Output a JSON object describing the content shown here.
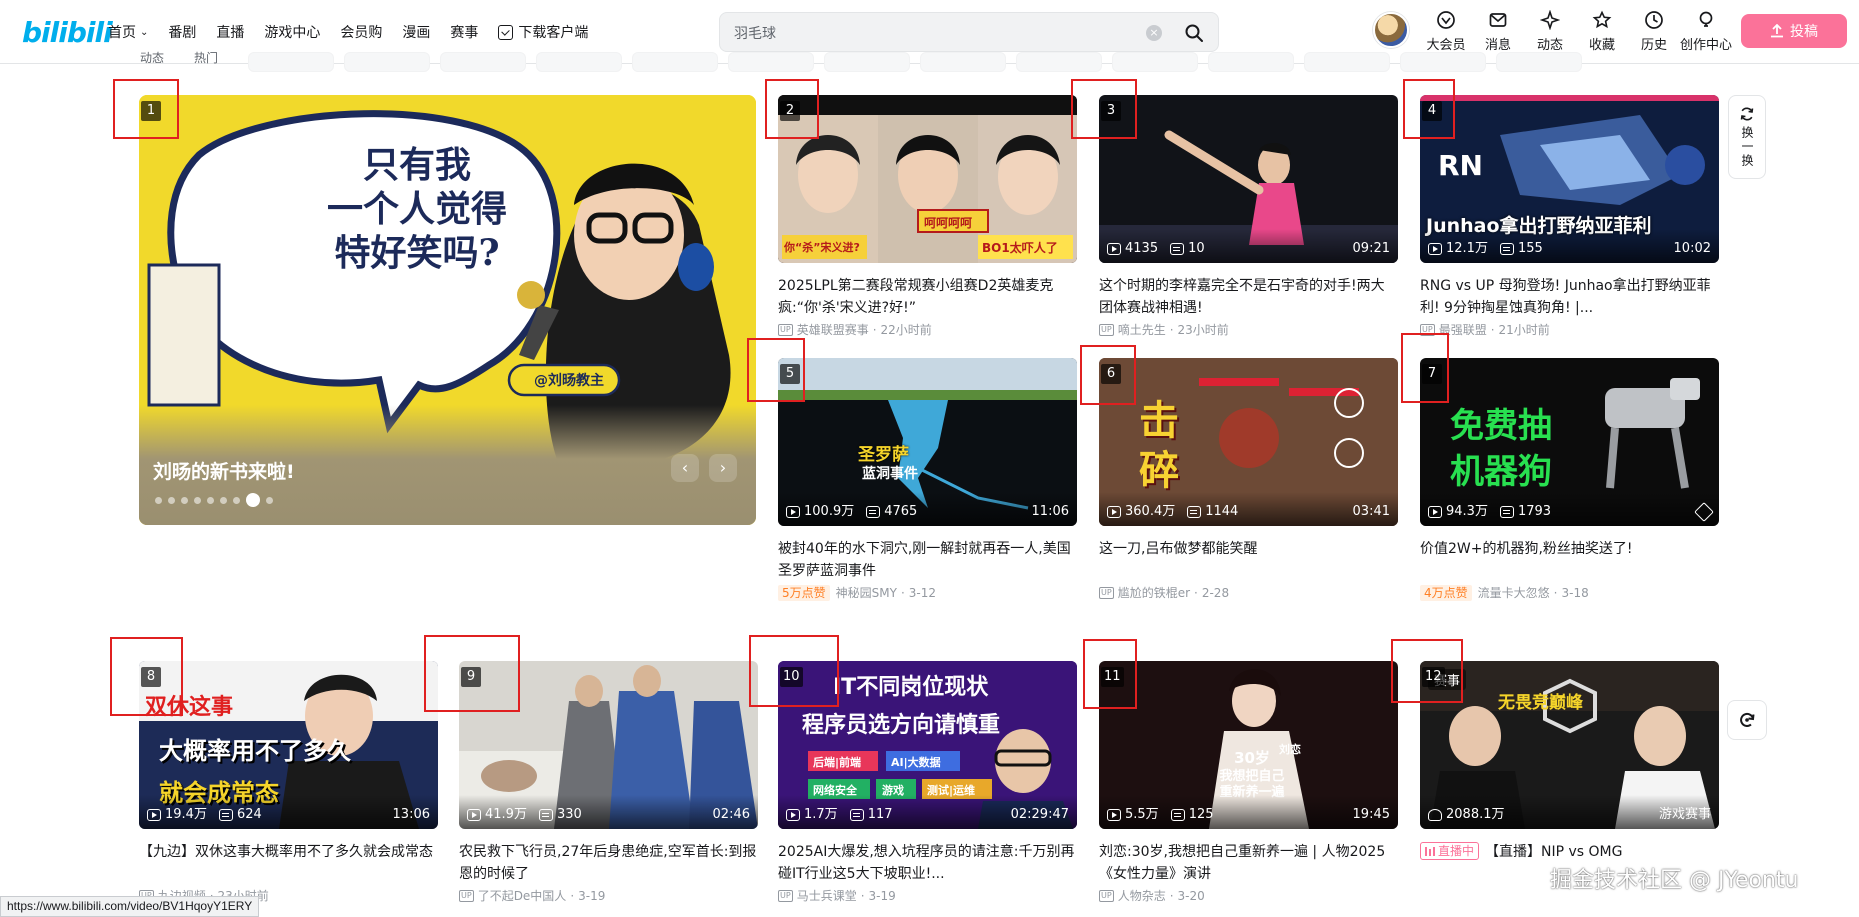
{
  "header": {
    "logo": "bilibili",
    "nav": [
      {
        "label": "首页",
        "has_dropdown": true
      },
      {
        "label": "番剧"
      },
      {
        "label": "直播"
      },
      {
        "label": "游戏中心"
      },
      {
        "label": "会员购"
      },
      {
        "label": "漫画"
      },
      {
        "label": "赛事"
      },
      {
        "label": "下载客户端",
        "icon": "download-icon"
      }
    ],
    "search": {
      "value": "羽毛球"
    },
    "right_icons": [
      {
        "label": "大会员",
        "icon": "vip-icon"
      },
      {
        "label": "消息",
        "icon": "message-icon"
      },
      {
        "label": "动态",
        "icon": "dynamic-icon"
      },
      {
        "label": "收藏",
        "icon": "favorite-icon"
      },
      {
        "label": "历史",
        "icon": "history-icon"
      },
      {
        "label": "创作中心",
        "icon": "creator-icon"
      }
    ],
    "upload_label": "投稿",
    "channel_labels": [
      "动态",
      "热门"
    ]
  },
  "carousel": {
    "title": "刘旸的新书来啦!",
    "dot_count": 10,
    "active_dot": 8,
    "overlay_lines": [
      "只有我",
      "一个人觉得",
      "特好笑吗?"
    ],
    "author_tag": "@刘旸教主"
  },
  "cards": [
    {
      "num": "2",
      "plays": "",
      "danmaku": "",
      "duration": "",
      "title": "2025LPL第二赛段常规赛小组赛D2英雄麦克疯:“你'杀'宋义进?好!”",
      "author": "英雄联盟赛事",
      "date": "22小时前",
      "overlay": [
        "你“杀”宋义进?",
        "呵呵呵呵",
        "BO1太吓人了"
      ]
    },
    {
      "num": "3",
      "plays": "4135",
      "danmaku": "10",
      "duration": "09:21",
      "title": "这个时期的李梓嘉完全不是石宇奇的对手!两大团体赛战神相遇!",
      "author": "嘀土先生",
      "date": "23小时前",
      "overlay": []
    },
    {
      "num": "4",
      "plays": "12.1万",
      "danmaku": "155",
      "duration": "10:02",
      "title": "RNG vs UP 母狗登场! Junhao拿出打野纳亚菲利! 9分钟掏星蚀真狗角! |...",
      "author": "最强联盟",
      "date": "21小时前",
      "overlay": [
        "Junhao拿出打野纳亚菲利"
      ]
    },
    {
      "num": "5",
      "plays": "100.9万",
      "danmaku": "4765",
      "duration": "11:06",
      "title": "被封40年的水下洞穴,刚一解封就再吞一人,美国圣罗萨蓝洞事件",
      "likes": "5万点赞",
      "author": "神秘园SMY",
      "date": "3-12",
      "overlay": [
        "圣罗萨",
        "蓝洞事件"
      ]
    },
    {
      "num": "6",
      "plays": "360.4万",
      "danmaku": "1144",
      "duration": "03:41",
      "title": "这一刀,吕布做梦都能笑醒",
      "author": "尴尬的铁棍er",
      "date": "2-28",
      "overlay": [
        "击",
        "碎"
      ]
    },
    {
      "num": "7",
      "plays": "94.3万",
      "danmaku": "1793",
      "duration": "",
      "title": "价值2W+的机器狗,粉丝抽奖送了!",
      "likes": "4万点赞",
      "author": "流量卡大忽悠",
      "date": "3-18",
      "overlay": [
        "免费抽",
        "机器狗"
      ]
    },
    {
      "num": "8",
      "plays": "19.4万",
      "danmaku": "624",
      "duration": "13:06",
      "title": "【九边】双休这事大概率用不了多久就会成常态",
      "author": "九边视频",
      "date": "23小时前",
      "overlay": [
        "双休这事",
        "大概率用不了多久",
        "就会成常态"
      ]
    },
    {
      "num": "9",
      "plays": "41.9万",
      "danmaku": "330",
      "duration": "02:46",
      "title": "农民救下飞行员,27年后身患绝症,空军首长:到报恩的时候了",
      "author": "了不起De中国人",
      "date": "3-19",
      "overlay": []
    },
    {
      "num": "10",
      "plays": "1.7万",
      "danmaku": "117",
      "duration": "02:29:47",
      "title": "2025AI大爆发,想入坑程序员的请注意:千万别再碰IT行业这5大下坡职业!...",
      "author": "马士兵课堂",
      "date": "3-19",
      "overlay": [
        "IT不同岗位现状",
        "程序员选方向请慎重",
        "后端|前端",
        "AI|大数据",
        "网络安全",
        "游戏",
        "测试|运维"
      ]
    },
    {
      "num": "11",
      "plays": "5.5万",
      "danmaku": "125",
      "duration": "19:45",
      "title": "刘恋:30岁,我想把自己重新养一遍 | 人物2025《女性力量》演讲",
      "author": "人物杂志",
      "date": "3-20",
      "overlay": [
        "30岁",
        "我想把自己",
        "重新养一遍",
        "刘恋"
      ]
    },
    {
      "num": "12",
      "plays": "2088.1万",
      "danmaku": "",
      "duration": "",
      "badge": "赛事",
      "corner_tag": "游戏赛事",
      "live_label": "直播中",
      "title": "【直播】NIP vs OMG",
      "author": "",
      "date": "",
      "overlay": [
        "无畏竞巅峰"
      ]
    }
  ],
  "carousel_num": "1",
  "refresh_label": "换一换",
  "status_url": "https://www.bilibili.com/video/BV1HqoyY1ERY",
  "watermark": "掘金技术社区 @ JYeontu"
}
